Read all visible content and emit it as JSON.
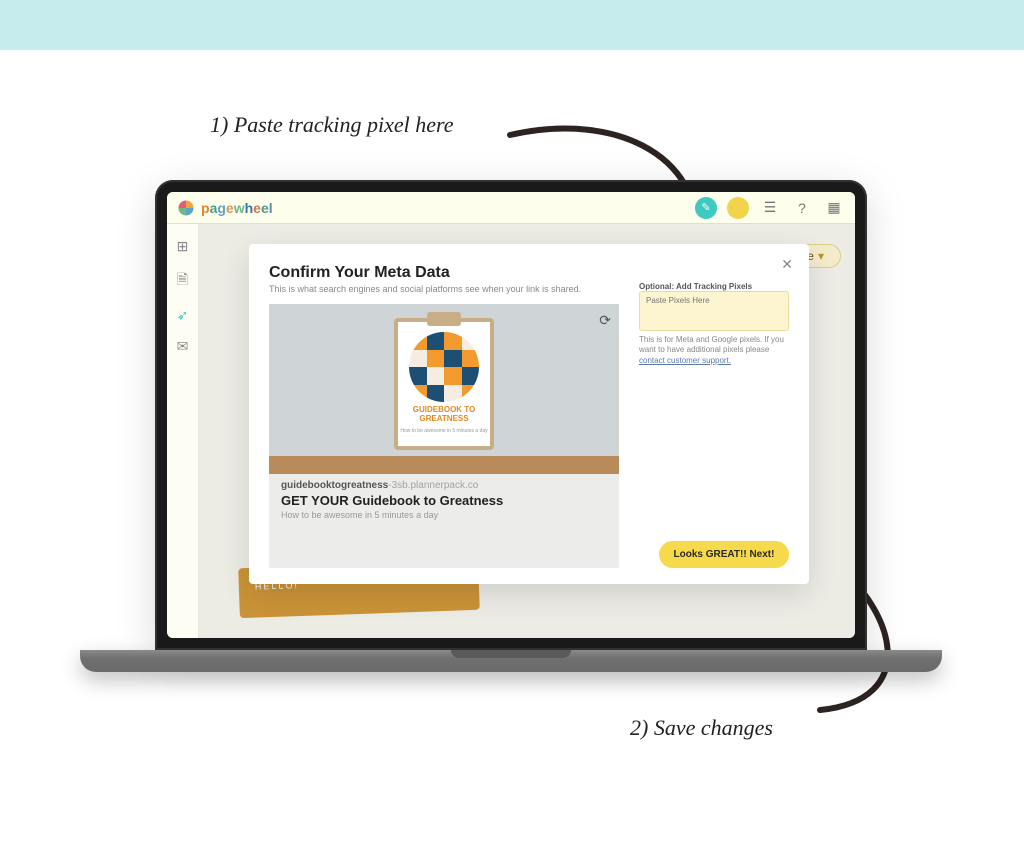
{
  "annotation1": "1) Paste tracking pixel here",
  "annotation2": "2) Save changes",
  "brand_letters": [
    "p",
    "a",
    "g",
    "e",
    "w",
    "h",
    "e",
    "e",
    "l"
  ],
  "free_pill": "Free",
  "backstage_label": "HELLO!",
  "modal": {
    "title": "Confirm Your Meta Data",
    "subtitle": "This is what search engines and social platforms see when your link is shared.",
    "slug_bold": "guidebooktogreatness",
    "slug_rest": "-3sb.plannerpack.co",
    "preview_title": "GET YOUR Guidebook to Greatness",
    "preview_desc": "How to be awesome in 5 minutes a day",
    "clipboard_title": "GUIDEBOOK TO GREATNESS",
    "clipboard_sub": "How to be awesome in 5 minutes a day"
  },
  "pixels": {
    "label": "Optional: Add Tracking Pixels",
    "placeholder": "Paste Pixels Here",
    "note_before": "This is for Meta and Google pixels. If you want to have additional pixels please ",
    "note_link": "contact customer support."
  },
  "next_button": "Looks GREAT!! Next!"
}
